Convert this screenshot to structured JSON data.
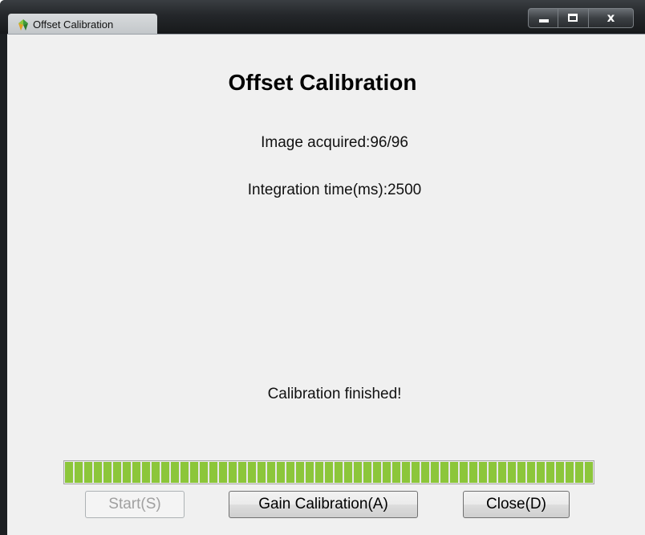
{
  "window": {
    "title": "Offset Calibration",
    "icon": "app-logo-icon"
  },
  "caption_buttons": {
    "minimize_icon": "minimize-icon",
    "maximize_icon": "maximize-icon",
    "close_label": "x"
  },
  "dialog": {
    "heading": "Offset Calibration",
    "images_acquired": "Image acquired:96/96",
    "integration_time": "Integration time(ms):2500",
    "status": "Calibration finished!",
    "progress_fraction": 1.0
  },
  "buttons": {
    "start_label": "Start(S)",
    "gain_label": "Gain Calibration(A)",
    "close_label": "Close(D)"
  },
  "colors": {
    "progress_green": "#8cc63a",
    "dialog_background": "#f0f0f0",
    "title_bar": "#1c1f22"
  }
}
